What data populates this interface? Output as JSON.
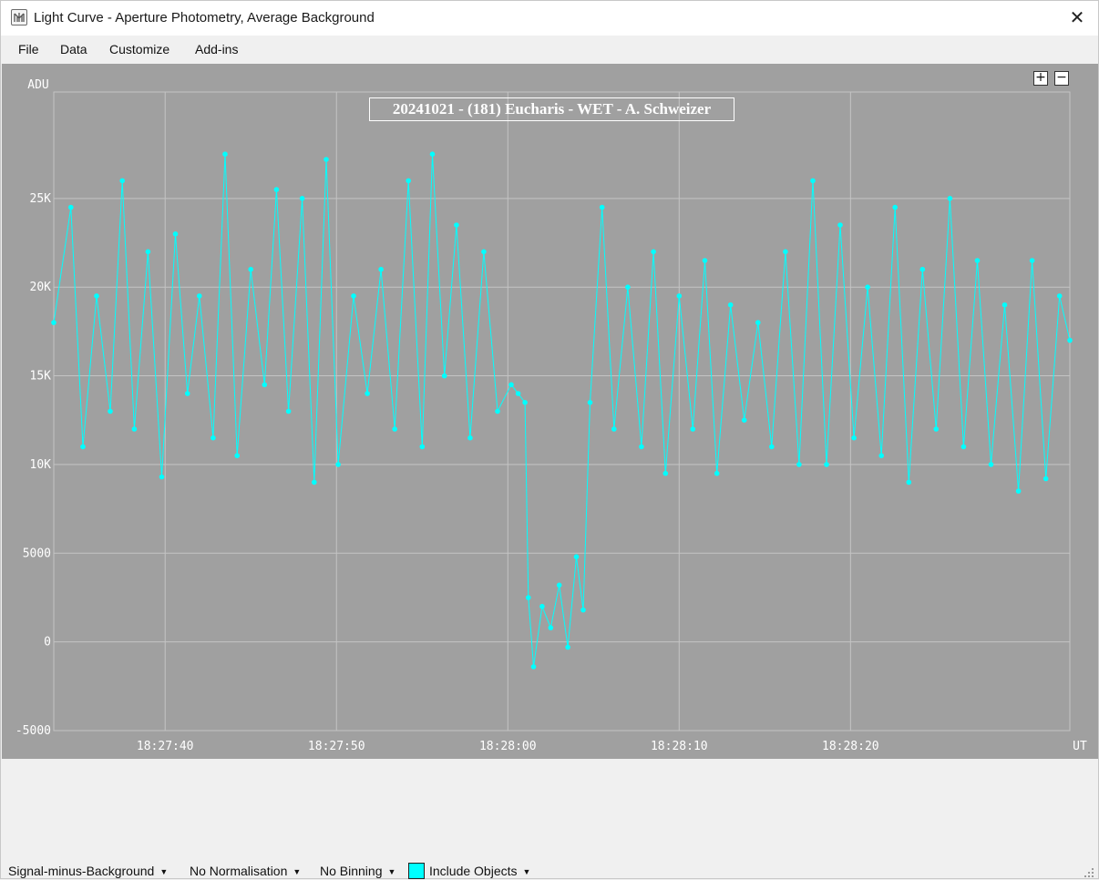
{
  "window": {
    "title": "Light Curve - Aperture Photometry, Average Background",
    "close_glyph": "✕"
  },
  "menu": [
    "File",
    "Data",
    "Customize",
    "Add-ins"
  ],
  "zoom": {
    "in": "+",
    "out": "−"
  },
  "status": {
    "mode": "Signal-minus-Background",
    "normalisation": "No Normalisation",
    "binning": "No Binning",
    "objects": "Include Objects",
    "objects_color": "#00ffff"
  },
  "colors": {
    "plot_bg": "#a0a0a0",
    "grid": "#c4c4c4",
    "series": "#00ffff",
    "text": "#ffffff"
  },
  "chart_data": {
    "type": "line",
    "title": "20241021 - (181) Eucharis - WET - A. Schweizer",
    "ylabel": "ADU",
    "xlabel": "UT",
    "ylim": [
      -5000,
      31000
    ],
    "xlim": [
      "18:27:33.5",
      "18:28:32.8"
    ],
    "y_ticks": [
      "-5000",
      "0",
      "5000",
      "10K",
      "15K",
      "20K",
      "25K"
    ],
    "x_ticks": [
      "18:27:40",
      "18:27:50",
      "18:28:00",
      "18:28:10",
      "18:28:20"
    ],
    "grid": true,
    "markers": true,
    "series": [
      {
        "points": [
          [
            "18:27:33.5",
            18000
          ],
          [
            "18:27:34.5",
            24500
          ],
          [
            "18:27:35.2",
            11000
          ],
          [
            "18:27:36.0",
            19500
          ],
          [
            "18:27:36.8",
            13000
          ],
          [
            "18:27:37.5",
            26000
          ],
          [
            "18:27:38.2",
            12000
          ],
          [
            "18:27:39.0",
            22000
          ],
          [
            "18:27:39.8",
            9300
          ],
          [
            "18:27:40.6",
            23000
          ],
          [
            "18:27:41.3",
            14000
          ],
          [
            "18:27:42.0",
            19500
          ],
          [
            "18:27:42.8",
            11500
          ],
          [
            "18:27:43.5",
            27500
          ],
          [
            "18:27:44.2",
            10500
          ],
          [
            "18:27:45.0",
            21000
          ],
          [
            "18:27:45.8",
            14500
          ],
          [
            "18:27:46.5",
            25500
          ],
          [
            "18:27:47.2",
            13000
          ],
          [
            "18:27:48.0",
            25000
          ],
          [
            "18:27:48.7",
            9000
          ],
          [
            "18:27:49.4",
            27200
          ],
          [
            "18:27:50.1",
            10000
          ],
          [
            "18:27:51.0",
            19500
          ],
          [
            "18:27:51.8",
            14000
          ],
          [
            "18:27:52.6",
            21000
          ],
          [
            "18:27:53.4",
            12000
          ],
          [
            "18:27:54.2",
            26000
          ],
          [
            "18:27:55.0",
            11000
          ],
          [
            "18:27:55.6",
            27500
          ],
          [
            "18:27:56.3",
            15000
          ],
          [
            "18:27:57.0",
            23500
          ],
          [
            "18:27:57.8",
            11500
          ],
          [
            "18:27:58.6",
            22000
          ],
          [
            "18:27:59.4",
            13000
          ],
          [
            "18:28:00.2",
            14500
          ],
          [
            "18:28:00.6",
            14000
          ],
          [
            "18:28:01.0",
            13500
          ],
          [
            "18:28:01.2",
            2500
          ],
          [
            "18:28:01.5",
            -1400
          ],
          [
            "18:28:02.0",
            2000
          ],
          [
            "18:28:02.5",
            800
          ],
          [
            "18:28:03.0",
            3200
          ],
          [
            "18:28:03.5",
            -300
          ],
          [
            "18:28:04.0",
            4800
          ],
          [
            "18:28:04.4",
            1800
          ],
          [
            "18:28:04.8",
            13500
          ],
          [
            "18:28:05.5",
            24500
          ],
          [
            "18:28:06.2",
            12000
          ],
          [
            "18:28:07.0",
            20000
          ],
          [
            "18:28:07.8",
            11000
          ],
          [
            "18:28:08.5",
            22000
          ],
          [
            "18:28:09.2",
            9500
          ],
          [
            "18:28:10.0",
            19500
          ],
          [
            "18:28:10.8",
            12000
          ],
          [
            "18:28:11.5",
            21500
          ],
          [
            "18:28:12.2",
            9500
          ],
          [
            "18:28:13.0",
            19000
          ],
          [
            "18:28:13.8",
            12500
          ],
          [
            "18:28:14.6",
            18000
          ],
          [
            "18:28:15.4",
            11000
          ],
          [
            "18:28:16.2",
            22000
          ],
          [
            "18:28:17.0",
            10000
          ],
          [
            "18:28:17.8",
            26000
          ],
          [
            "18:28:18.6",
            10000
          ],
          [
            "18:28:19.4",
            23500
          ],
          [
            "18:28:20.2",
            11500
          ],
          [
            "18:28:21.0",
            20000
          ],
          [
            "18:28:21.8",
            10500
          ],
          [
            "18:28:22.6",
            24500
          ],
          [
            "18:28:23.4",
            9000
          ],
          [
            "18:28:24.2",
            21000
          ],
          [
            "18:28:25.0",
            12000
          ],
          [
            "18:28:25.8",
            25000
          ],
          [
            "18:28:26.6",
            11000
          ],
          [
            "18:28:27.4",
            21500
          ],
          [
            "18:28:28.2",
            10000
          ],
          [
            "18:28:29.0",
            19000
          ],
          [
            "18:28:29.8",
            8500
          ],
          [
            "18:28:30.6",
            21500
          ],
          [
            "18:28:31.4",
            9200
          ],
          [
            "18:28:32.2",
            19500
          ],
          [
            "18:28:32.8",
            17000
          ]
        ]
      }
    ]
  }
}
